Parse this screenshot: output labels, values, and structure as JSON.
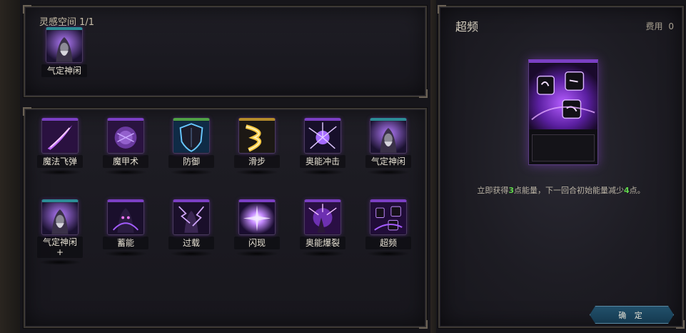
{
  "inspiration": {
    "label": "灵感空间 1/1",
    "cards": [
      {
        "name": "气定神闲",
        "icon": "hooded-monk-icon",
        "frame": "teal"
      }
    ]
  },
  "deck": {
    "cards": [
      {
        "name": "魔法飞弹",
        "icon": "magic-missile-icon",
        "frame": "purple"
      },
      {
        "name": "魔甲术",
        "icon": "mage-armor-icon",
        "frame": "purple"
      },
      {
        "name": "防御",
        "icon": "shield-icon",
        "frame": "green"
      },
      {
        "name": "滑步",
        "icon": "slide-step-icon",
        "frame": "gold"
      },
      {
        "name": "奥能冲击",
        "icon": "arcane-blast-icon",
        "frame": "purple"
      },
      {
        "name": "气定神闲",
        "icon": "hooded-monk-icon",
        "frame": "teal"
      },
      {
        "name": "气定神闲+",
        "icon": "hooded-monk-icon",
        "frame": "teal"
      },
      {
        "name": "蓄能",
        "icon": "charge-icon",
        "frame": "purple"
      },
      {
        "name": "过载",
        "icon": "overload-icon",
        "frame": "purple"
      },
      {
        "name": "闪现",
        "icon": "blink-icon",
        "frame": "purple"
      },
      {
        "name": "奥能爆裂",
        "icon": "arcane-burst-icon",
        "frame": "purple"
      },
      {
        "name": "超频",
        "icon": "overclock-runes-icon",
        "frame": "purple"
      }
    ]
  },
  "detail": {
    "title": "超频",
    "cost_label": "费用",
    "cost_value": "0",
    "icon": "overclock-runes-icon",
    "desc_a": "立即获得",
    "desc_num1": "3",
    "desc_b": "点能量，下一回合初始能量减少",
    "desc_num2": "4",
    "desc_c": "点。",
    "confirm_label": "确 定"
  },
  "colors": {
    "highlight": "#5fd34b",
    "arcane_purple": "#8a3fe0",
    "teal_frame": "#2c8c96",
    "button_blue": "#22506b"
  }
}
